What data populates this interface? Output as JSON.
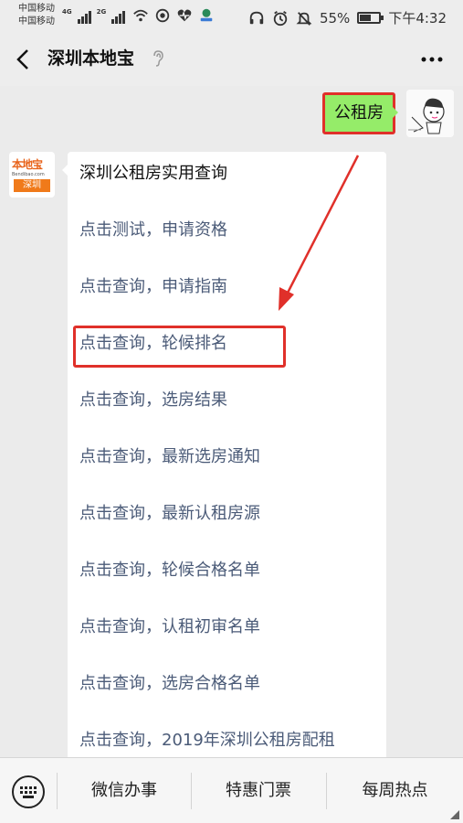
{
  "status_bar": {
    "carrier_1": "中国移动",
    "carrier_2": "中国移动",
    "net_1": "4G",
    "net_2": "2G",
    "battery": "55%",
    "time": "下午4:32"
  },
  "navbar": {
    "title": "深圳本地宝"
  },
  "chat": {
    "outgoing": {
      "text": "公租房"
    },
    "bot_avatar": {
      "line1": "本地宝",
      "line2": "Bendibao.com",
      "line3": "深圳"
    },
    "incoming": {
      "title": "深圳公租房实用查询",
      "links": [
        "点击测试，申请资格",
        "点击查询，申请指南",
        "点击查询，轮候排名",
        "点击查询，选房结果",
        "点击查询，最新选房通知",
        "点击查询，最新认租房源",
        "点击查询，轮候合格名单",
        "点击查询，认租初审名单",
        "点击查询，选房合格名单",
        "点击查询，2019年深圳公租房配租"
      ]
    }
  },
  "bottom_menu": {
    "items": [
      "微信办事",
      "特惠门票",
      "每周热点"
    ]
  },
  "colors": {
    "highlight_red": "#e0302a",
    "bubble_green": "#95ec69",
    "link_color": "#4b5b78"
  }
}
